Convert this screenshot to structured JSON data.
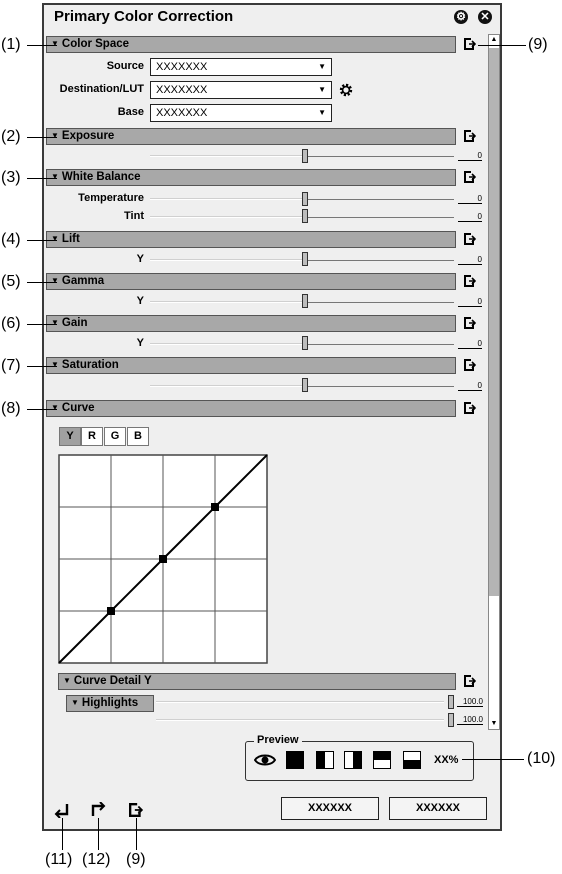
{
  "window": {
    "title": "Primary Color Correction"
  },
  "sections": {
    "color_space": "Color Space",
    "exposure": "Exposure",
    "white_balance": "White Balance",
    "lift": "Lift",
    "gamma": "Gamma",
    "gain": "Gain",
    "saturation": "Saturation",
    "curve": "Curve",
    "curve_detail": "Curve Detail Y",
    "highlights": "Highlights"
  },
  "color_space": {
    "source_label": "Source",
    "source_value": "XXXXXXX",
    "dest_label": "Destination/LUT",
    "dest_value": "XXXXXXX",
    "base_label": "Base",
    "base_value": "XXXXXXX"
  },
  "sliders": {
    "exposure": "0",
    "temperature_label": "Temperature",
    "temperature": "0",
    "tint_label": "Tint",
    "tint": "0",
    "lift_label": "Y",
    "lift": "0",
    "gamma_label": "Y",
    "gamma": "0",
    "gain_label": "Y",
    "gain": "0",
    "saturation": "0",
    "highlights_1": "100.0",
    "highlights_2": "100.0"
  },
  "curve": {
    "tabs": [
      "Y",
      "R",
      "G",
      "B"
    ],
    "selected": "Y",
    "points": [
      [
        0,
        0
      ],
      [
        0.25,
        0.25
      ],
      [
        0.5,
        0.5
      ],
      [
        0.75,
        0.75
      ],
      [
        1,
        1
      ]
    ]
  },
  "preview": {
    "label": "Preview",
    "zoom": "XX%"
  },
  "buttons": {
    "ok": "XXXXXX",
    "cancel": "XXXXXX"
  },
  "callouts": {
    "c1": "(1)",
    "c2": "(2)",
    "c3": "(3)",
    "c4": "(4)",
    "c5": "(5)",
    "c6": "(6)",
    "c7": "(7)",
    "c8": "(8)",
    "c9": "(9)",
    "c10": "(10)",
    "c11": "(11)",
    "c12": "(12)",
    "c9b": "(9)"
  }
}
